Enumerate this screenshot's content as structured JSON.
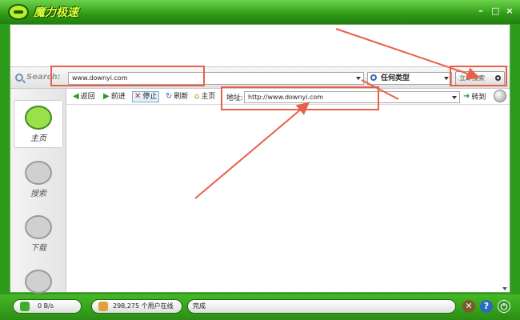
{
  "app": {
    "title": "魔力极速",
    "window_controls": {
      "minimize": "–",
      "maximize": "□",
      "close": "×"
    }
  },
  "search": {
    "label": "Search:",
    "value": "www.downyi.com",
    "type_select": "任何类型",
    "button_label": "立即搜索"
  },
  "nav": {
    "back": "返回",
    "forward": "前进",
    "stop": "停止",
    "refresh": "刷新",
    "home": "主页",
    "address_label": "地址:",
    "address_value": "http://www.downyi.com",
    "go": "转到"
  },
  "sidebar": {
    "items": [
      {
        "label": "主页",
        "icon": "home-mascot-icon",
        "active": true
      },
      {
        "label": "搜索",
        "icon": "search-mascot-icon",
        "active": false
      },
      {
        "label": "下载",
        "icon": "download-mascot-icon",
        "active": false
      }
    ]
  },
  "status": {
    "speed": "0 B/s",
    "users": "298,275 个用户在线",
    "state": "完成"
  },
  "colors": {
    "frame_green": "#2d9b1a",
    "annotation_red": "#e8604a",
    "logo_yellow": "#d7ff3a"
  }
}
